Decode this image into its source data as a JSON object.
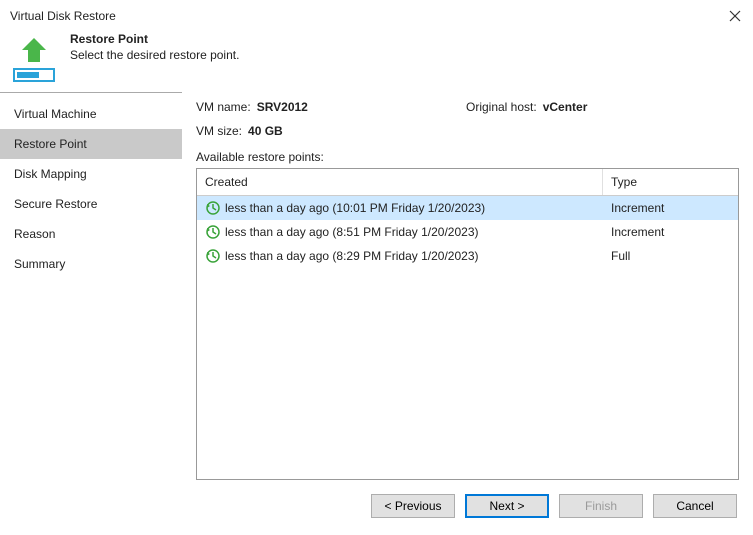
{
  "window": {
    "title": "Virtual Disk Restore"
  },
  "header": {
    "title": "Restore Point",
    "subtitle": "Select the desired restore point."
  },
  "sidebar": {
    "items": [
      {
        "label": "Virtual Machine"
      },
      {
        "label": "Restore Point"
      },
      {
        "label": "Disk Mapping"
      },
      {
        "label": "Secure Restore"
      },
      {
        "label": "Reason"
      },
      {
        "label": "Summary"
      }
    ],
    "selected_index": 1
  },
  "info": {
    "vm_name_label": "VM name:",
    "vm_name": "SRV2012",
    "vm_size_label": "VM size:",
    "vm_size": "40 GB",
    "host_label": "Original host:",
    "host": "vCenter"
  },
  "available_label": "Available restore points:",
  "grid": {
    "columns": {
      "created": "Created",
      "type": "Type"
    },
    "rows": [
      {
        "created": "less than a day ago (10:01 PM Friday 1/20/2023)",
        "type": "Increment",
        "selected": true
      },
      {
        "created": "less than a day ago (8:51 PM Friday 1/20/2023)",
        "type": "Increment",
        "selected": false
      },
      {
        "created": "less than a day ago (8:29 PM Friday 1/20/2023)",
        "type": "Full",
        "selected": false
      }
    ]
  },
  "buttons": {
    "previous": "< Previous",
    "next": "Next >",
    "finish": "Finish",
    "cancel": "Cancel"
  }
}
